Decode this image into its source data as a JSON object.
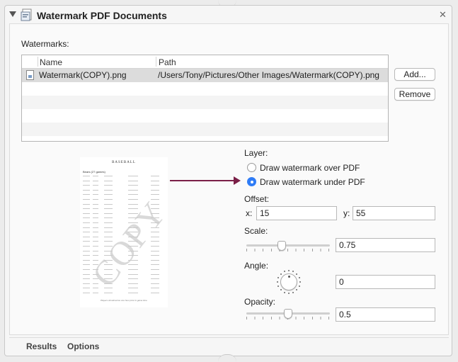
{
  "action": {
    "title": "Watermark PDF Documents"
  },
  "watermarks": {
    "label": "Watermarks:",
    "columns": [
      "Name",
      "Path"
    ],
    "rows": [
      {
        "name": "Watermark(COPY).png",
        "path": "/Users/Tony/Pictures/Other Images/Watermark(COPY).png",
        "selected": true
      }
    ],
    "add_label": "Add...",
    "remove_label": "Remove"
  },
  "preview": {
    "doc_title": "BASEBALL",
    "doc_heading": "Bears (27 games)",
    "watermark_text": "COPY",
    "doc_footer": "Players should arrive one hour prior to game time"
  },
  "layer": {
    "label": "Layer:",
    "options": [
      "Draw watermark over PDF",
      "Draw watermark under PDF"
    ],
    "selected_index": 1
  },
  "offset": {
    "label": "Offset:",
    "x_label": "x:",
    "x": "15",
    "y_label": "y:",
    "y": "55"
  },
  "scale": {
    "label": "Scale:",
    "value": "0.75",
    "slider_fraction": 0.42
  },
  "angle": {
    "label": "Angle:",
    "value": "0"
  },
  "opacity": {
    "label": "Opacity:",
    "value": "0.5",
    "slider_fraction": 0.5
  },
  "footer_tabs": [
    "Results",
    "Options"
  ],
  "colors": {
    "arrow": "#7a1f47",
    "radio_selected": "#2f7cf6",
    "selected_row": "#dcdcdc"
  }
}
